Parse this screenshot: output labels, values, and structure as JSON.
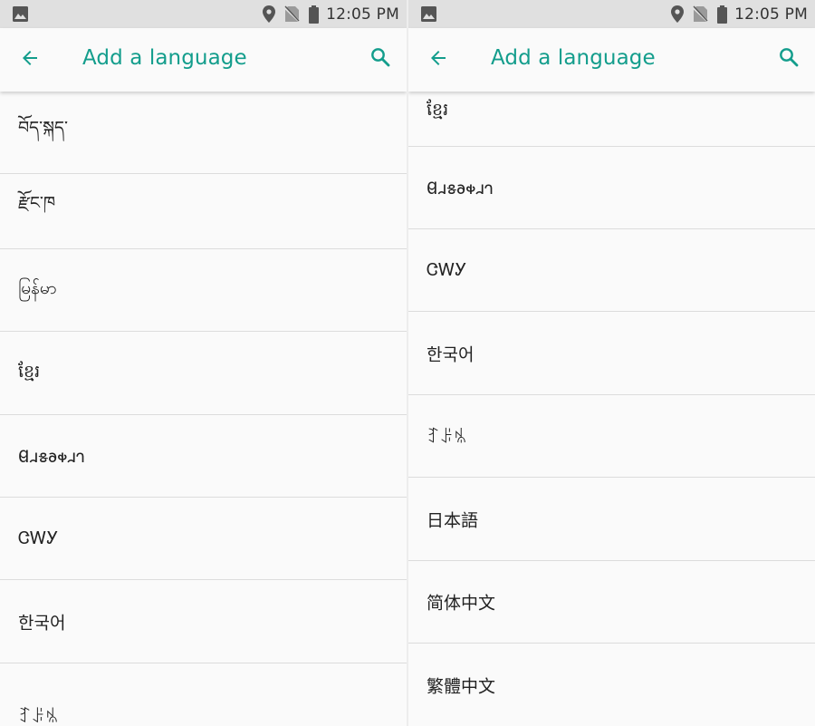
{
  "status_bar": {
    "time": "12:05 PM",
    "icons": [
      "image-icon",
      "location-icon",
      "no-sim-icon",
      "battery-icon"
    ]
  },
  "app_bar": {
    "title": "Add a language",
    "back_icon": "arrow-back-icon",
    "search_icon": "search-icon",
    "accent_color": "#139d8c"
  },
  "left_screen": {
    "languages": [
      "བོད་སྐད་",
      "རྫོང་ཁ",
      "မြန်မာ",
      "ខ្មែរ",
      "𐐔𐐯𐑅𐐨𐑉𐐯𐐻",
      "ᏣᎳᎩ",
      "한국어",
      "ꆈꌠꁱ"
    ]
  },
  "right_screen": {
    "languages": [
      "ខ្មែរ",
      "𐐔𐐯𐑅𐐨𐑉𐐯𐐻",
      "ᏣᎳᎩ",
      "한국어",
      "ꆈꌠꁱ",
      "日本語",
      "简体中文",
      "繁體中文"
    ]
  }
}
